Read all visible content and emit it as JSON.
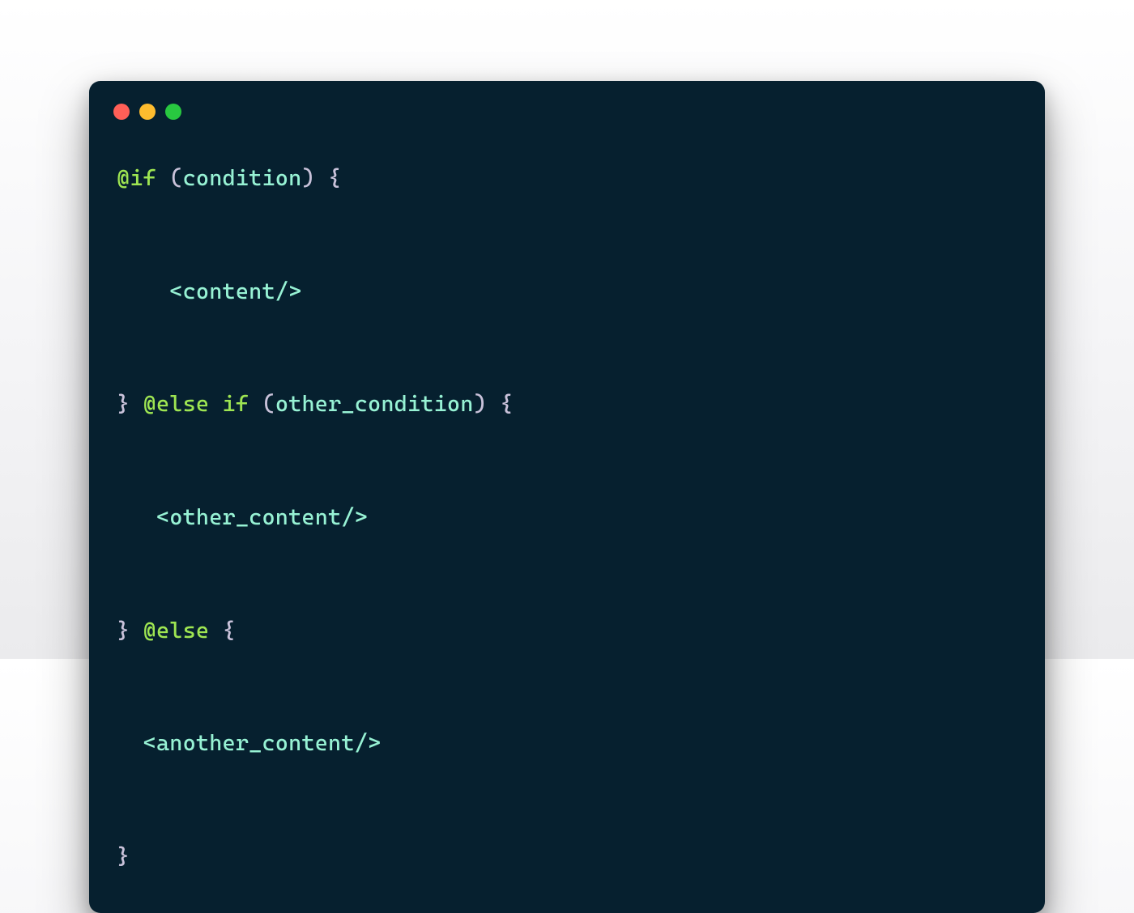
{
  "colors": {
    "close": "#ff5f57",
    "minimize": "#febc2e",
    "zoom": "#28c840"
  },
  "code": {
    "l1_kw": "@if",
    "l1_open": " (",
    "l1_id": "condition",
    "l1_close": ") {",
    "l2_indent": "    <",
    "l2_tag": "content",
    "l2_end": "/>",
    "l3_brace": "} ",
    "l3_kw1": "@else",
    "l3_sp": " ",
    "l3_kw2": "if",
    "l3_open": " (",
    "l3_id": "other_condition",
    "l3_close": ") {",
    "l4_indent": "   <",
    "l4_tag": "other_content",
    "l4_end": "/>",
    "l5_brace": "} ",
    "l5_kw": "@else",
    "l5_close": " {",
    "l6_indent": "  <",
    "l6_tag": "another_content",
    "l6_end": "/>",
    "l7_brace": "}"
  }
}
